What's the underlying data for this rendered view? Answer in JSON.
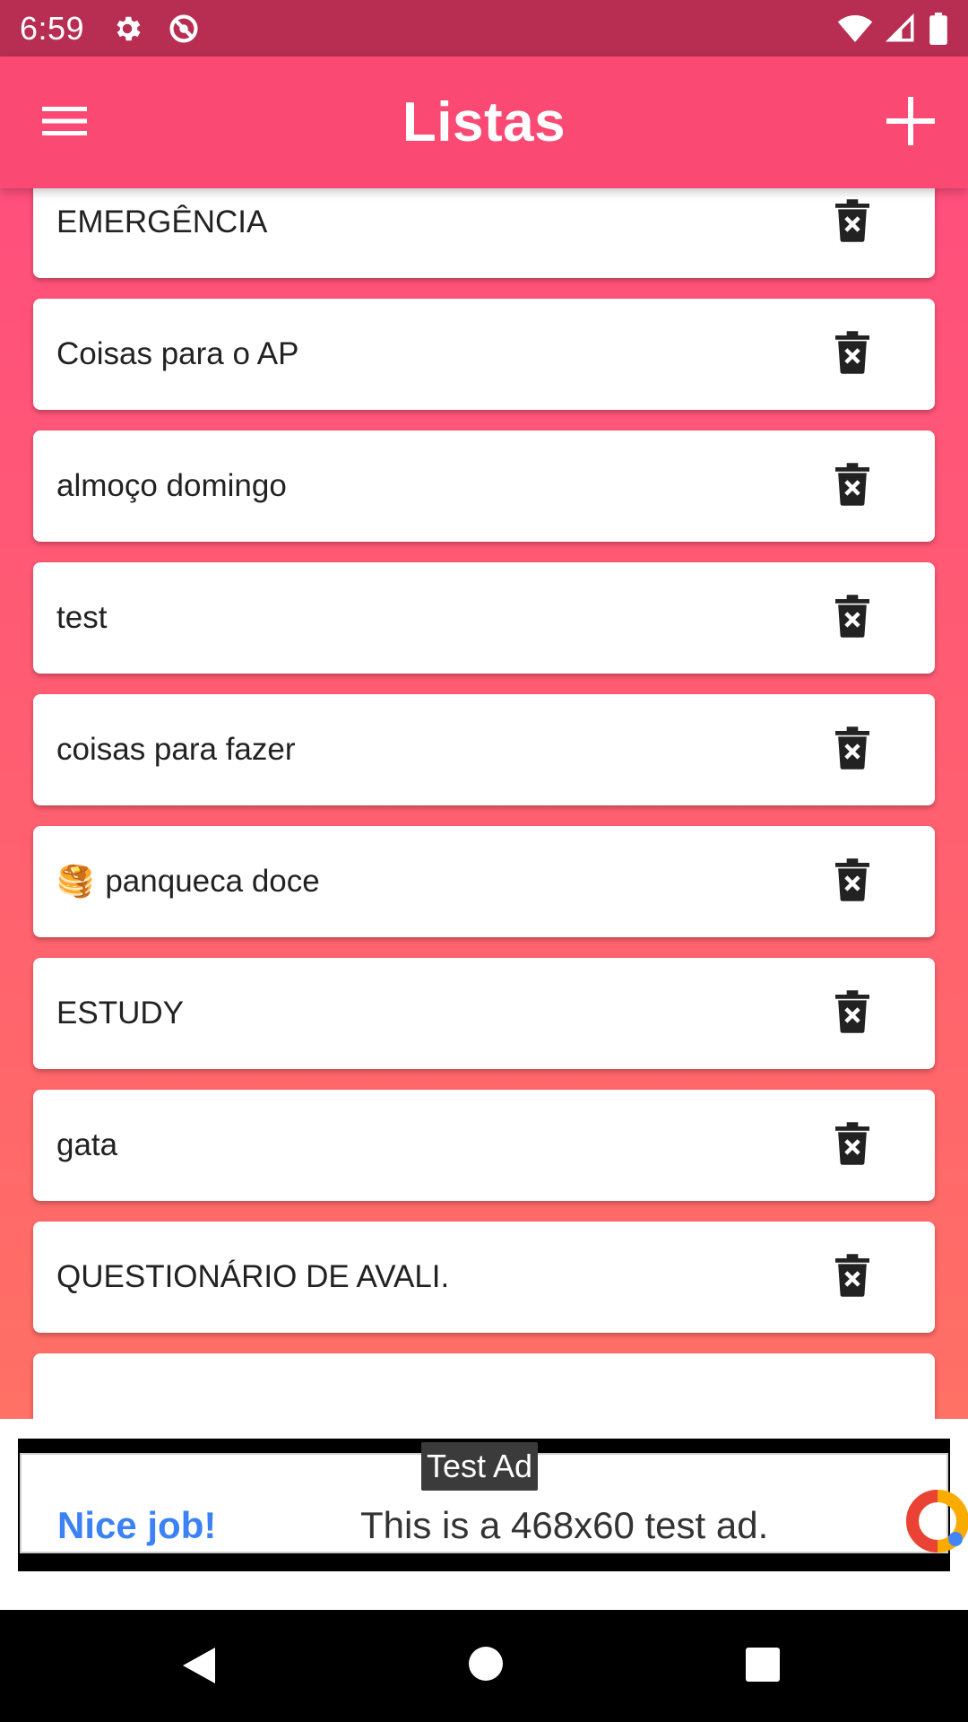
{
  "status_bar": {
    "time": "6:59",
    "icons": [
      "settings-icon",
      "data-saver-icon",
      "wifi-icon",
      "signal-icon",
      "battery-icon"
    ]
  },
  "app_bar": {
    "title": "Listas",
    "menu_icon": "hamburger-menu-icon",
    "add_icon": "plus-icon",
    "color": "#fa4a74"
  },
  "lists": [
    {
      "emoji": "",
      "label": "EMERGÊNCIA"
    },
    {
      "emoji": "",
      "label": "Coisas para o AP"
    },
    {
      "emoji": "",
      "label": "almoço domingo"
    },
    {
      "emoji": "",
      "label": "test"
    },
    {
      "emoji": "",
      "label": "coisas para fazer"
    },
    {
      "emoji": "🥞",
      "label": "panqueca doce"
    },
    {
      "emoji": "",
      "label": "ESTUDY"
    },
    {
      "emoji": "",
      "label": "gata"
    },
    {
      "emoji": "",
      "label": "QUESTIONÁRIO DE AVALI."
    },
    {
      "emoji": "",
      "label": ""
    }
  ],
  "ad": {
    "badge": "Test Ad",
    "headline": "Nice job!",
    "body": "This is a 468x60 test ad."
  },
  "nav_bar": {
    "icons": [
      "back-icon",
      "home-icon",
      "recents-icon"
    ]
  }
}
